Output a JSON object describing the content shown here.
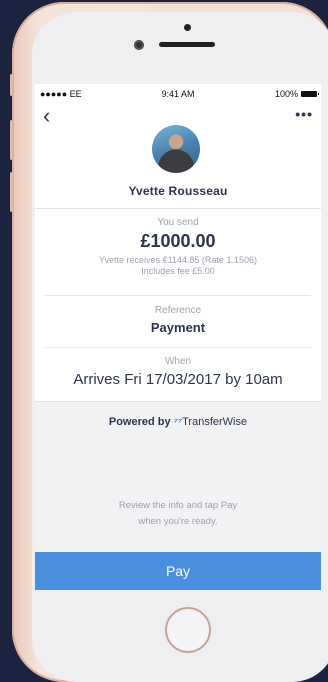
{
  "status_bar": {
    "carrier": "●●●●● EE",
    "time": "9:41 AM",
    "battery": "100%"
  },
  "nav": {
    "back": "‹",
    "more": "•••"
  },
  "recipient": {
    "name": "Yvette Rousseau"
  },
  "send": {
    "label": "You send",
    "amount": "£1000.00",
    "receives": "Yvette receives €1144.85 (Rate 1.1506)",
    "fee": "Includes fee £5.00"
  },
  "reference": {
    "label": "Reference",
    "value": "Payment"
  },
  "when": {
    "label": "When",
    "value": "Arrives Fri 17/03/2017 by 10am"
  },
  "powered": {
    "prefix": "Powered by",
    "logo_mark": "⁷⁷",
    "brand": "TransferWise"
  },
  "review": {
    "line1": "Review the info and tap Pay",
    "line2": "when you're ready."
  },
  "pay": {
    "label": "Pay"
  },
  "colors": {
    "accent": "#4a8fe0",
    "text": "#2c3550",
    "muted": "#9ca2ad",
    "background": "#1c2340"
  }
}
